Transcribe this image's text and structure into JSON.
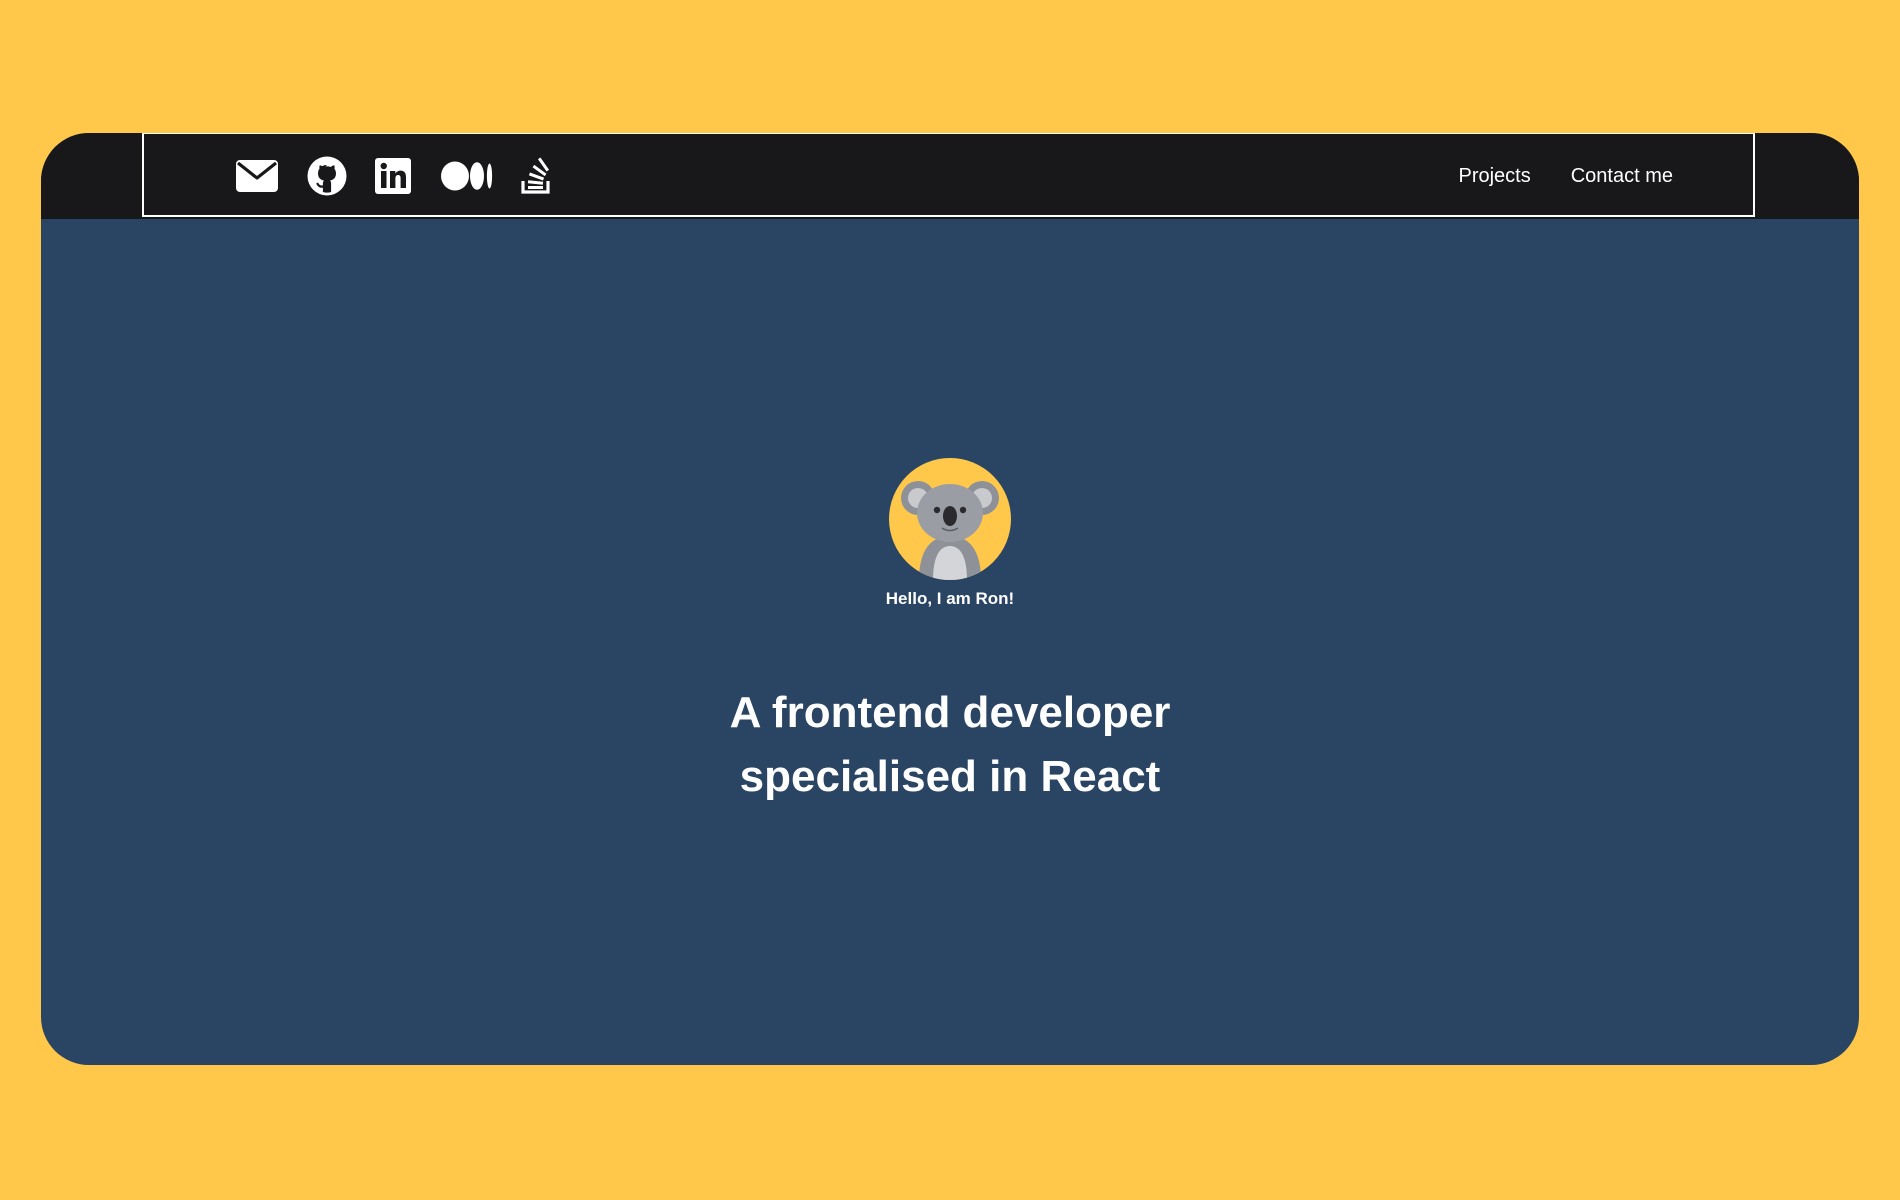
{
  "colors": {
    "page_background": "#FFC84A",
    "header_background": "#18181B",
    "hero_background": "#2A4563",
    "text": "#FFFFFF",
    "avatar_background": "#FFC84A"
  },
  "header": {
    "social_icons": [
      "mail-icon",
      "github-icon",
      "linkedin-icon",
      "medium-icon",
      "stackoverflow-icon"
    ],
    "nav_links": {
      "projects": "Projects",
      "contact": "Contact me"
    }
  },
  "hero": {
    "avatar_icon": "koala-avatar",
    "greeting": "Hello, I am Ron!",
    "headline_line1": "A frontend developer",
    "headline_line2": "specialised in React"
  }
}
